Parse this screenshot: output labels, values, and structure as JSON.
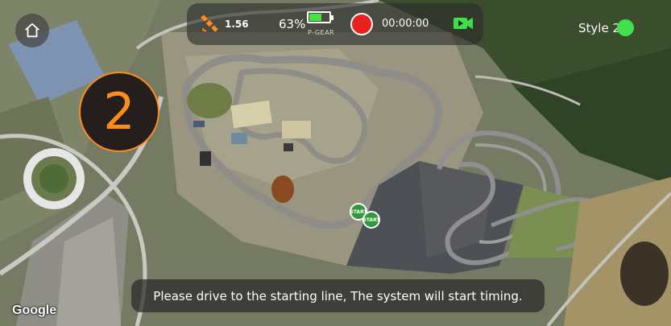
{
  "status": {
    "satellite_value": "1.56",
    "battery_percent": "63%",
    "battery_level": 0.63,
    "gear": "P-GEAR",
    "timer": "00:00:00"
  },
  "style_label": "Style 2",
  "countdown": "2",
  "start_markers": [
    "START",
    "START"
  ],
  "message": "Please drive to the starting line, The system will start timing.",
  "map_attribution": "Google",
  "colors": {
    "accent_orange": "#ff8c1a",
    "battery_green": "#45e43e",
    "record_red": "#e8231f",
    "start_green": "#2e9a3a",
    "style_dot": "#3ee04b"
  },
  "icons": {
    "home": "home-icon",
    "satellite": "satellite-icon",
    "battery": "battery-icon",
    "record": "record-icon",
    "camera": "video-camera-icon"
  }
}
